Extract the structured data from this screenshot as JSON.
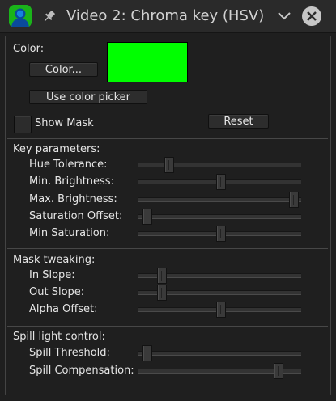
{
  "window": {
    "title": "Video 2: Chroma key (HSV)",
    "icon": "app-logo-icon",
    "pin_icon": "pin-icon",
    "collapse_icon": "chevron-down-icon",
    "close_icon": "close-icon"
  },
  "color_section": {
    "label": "Color:",
    "color_button": "Color...",
    "picker_button": "Use color picker",
    "swatch_color": "#00ff00"
  },
  "mask": {
    "show_mask_label": "Show Mask",
    "show_mask_checked": false,
    "reset_button": "Reset"
  },
  "key_parameters": {
    "heading": "Key parameters:",
    "sliders": [
      {
        "label": "Hue Tolerance:",
        "value": 0.17
      },
      {
        "label": "Min. Brightness:",
        "value": 0.5
      },
      {
        "label": "Max. Brightness:",
        "value": 0.975
      },
      {
        "label": "Saturation Offset:",
        "value": 0.025
      },
      {
        "label": "Min Saturation:",
        "value": 0.5
      }
    ]
  },
  "mask_tweaking": {
    "heading": "Mask tweaking:",
    "sliders": [
      {
        "label": "In Slope:",
        "value": 0.12
      },
      {
        "label": "Out Slope:",
        "value": 0.12
      },
      {
        "label": "Alpha Offset:",
        "value": 0.5
      }
    ]
  },
  "spill": {
    "heading": "Spill light control:",
    "sliders": [
      {
        "label": "Spill Threshold:",
        "value": 0.025
      },
      {
        "label": "Spill Compensation:",
        "value": 0.875
      }
    ]
  }
}
